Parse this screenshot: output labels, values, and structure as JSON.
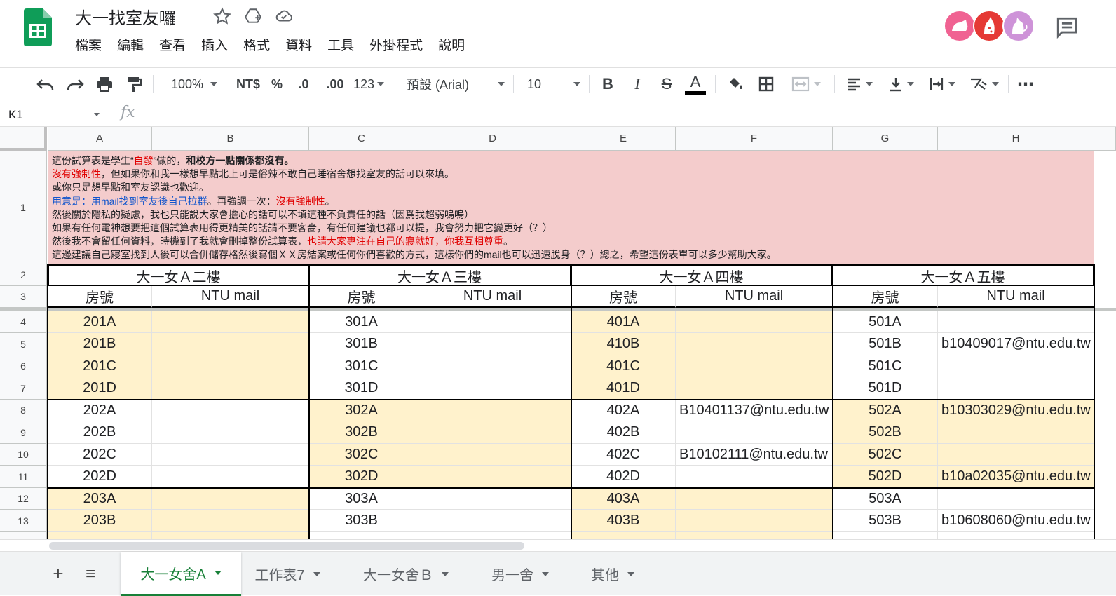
{
  "app": {
    "title": "大一找室友囉",
    "menu": [
      "檔案",
      "編輯",
      "查看",
      "插入",
      "格式",
      "資料",
      "工具",
      "外掛程式",
      "說明"
    ]
  },
  "toolbar": {
    "zoom": "100%",
    "currency": "NT$",
    "percent": "%",
    "dec_decrease": ".0",
    "dec_increase": ".00",
    "more_formats": "123",
    "font": "預設 (Arial)",
    "font_size": "10",
    "bold": "B",
    "italic": "I",
    "strike": "S",
    "text_color": "A",
    "more": "⋯"
  },
  "formula_bar": {
    "cell_ref": "K1",
    "fx": "fx",
    "value": ""
  },
  "columns": [
    "A",
    "B",
    "C",
    "D",
    "E",
    "F",
    "G",
    "H"
  ],
  "rows": [
    "1",
    "2",
    "3",
    "4",
    "5",
    "6",
    "7",
    "8",
    "9",
    "10",
    "11",
    "12",
    "13"
  ],
  "notes": {
    "l1a": "這份試算表是學生“",
    "l1b": "自發",
    "l1c": "”做的，",
    "l1d": "和校方一點關係都沒有。",
    "l2a": "沒有強制性",
    "l2b": "，但如果你和我一樣想早點北上可是俗辣不敢自己睡宿舍想找室友的話可以來填。",
    "l3": "或你只是想早點和室友認識也歡迎。",
    "l4a": "用意是：用mail找到室友後自己拉群",
    "l4b": "。再強調一次：",
    "l4c": "沒有強制性",
    "l4d": "。",
    "l5": "然後關於隱私的疑慮，我也只能說大家會擔心的話可以不填這種不負責任的話（因爲我超弱嗚嗚）",
    "l6": "如果有任何電神想要把這個試算表用得更精美的話請不要客嗇，有任何建議也都可以提，我會努力把它變更好（？）",
    "l7a": "然後我不會留任何資料，時機到了我就會刪掉整份試算表，",
    "l7b": "也請大家專注在自己的寢就好，你我互相尊重",
    "l7c": "。",
    "l8": "這邊建議自己寢室找到人後可以合併儲存格然後寫個ＸＸ房結案或任何你們喜歡的方式，這樣你們的mail也可以迅速脫身（？）總之，希望這份表單可以多少幫助大家。"
  },
  "floors": [
    "大一女Ａ二樓",
    "大一女Ａ三樓",
    "大一女Ａ四樓",
    "大一女Ａ五樓"
  ],
  "sub_headers": {
    "room": "房號",
    "mail": "NTU mail"
  },
  "table": [
    [
      "201A",
      "",
      "301A",
      "",
      "401A",
      "",
      "501A",
      ""
    ],
    [
      "201B",
      "",
      "301B",
      "",
      "410B",
      "",
      "501B",
      "b10409017@ntu.edu.tw"
    ],
    [
      "201C",
      "",
      "301C",
      "",
      "401C",
      "",
      "501C",
      ""
    ],
    [
      "201D",
      "",
      "301D",
      "",
      "401D",
      "",
      "501D",
      ""
    ],
    [
      "202A",
      "",
      "302A",
      "",
      "402A",
      "B10401137@ntu.edu.tw",
      "502A",
      "b10303029@ntu.edu.tw"
    ],
    [
      "202B",
      "",
      "302B",
      "",
      "402B",
      "",
      "502B",
      ""
    ],
    [
      "202C",
      "",
      "302C",
      "",
      "402C",
      "B10102111@ntu.edu.tw",
      "502C",
      ""
    ],
    [
      "202D",
      "",
      "302D",
      "",
      "402D",
      "",
      "502D",
      "b10a02035@ntu.edu.tw"
    ],
    [
      "203A",
      "",
      "303A",
      "",
      "403A",
      "",
      "503A",
      ""
    ],
    [
      "203B",
      "",
      "303B",
      "",
      "403B",
      "",
      "503B",
      "b10608060@ntu.edu.tw"
    ]
  ],
  "sheets": [
    {
      "label": "大一女舍A",
      "active": true
    },
    {
      "label": "工作表7",
      "active": false
    },
    {
      "label": "大一女舍Ｂ",
      "active": false
    },
    {
      "label": "男一舍",
      "active": false
    },
    {
      "label": "其他",
      "active": false
    }
  ],
  "sheet_controls": {
    "add": "+",
    "all": "≡"
  },
  "colors": {
    "cream": "#fff2cc",
    "pink": "#f4cccc",
    "accent": "#188038",
    "red": "#e00000",
    "blue": "#1155cc"
  }
}
